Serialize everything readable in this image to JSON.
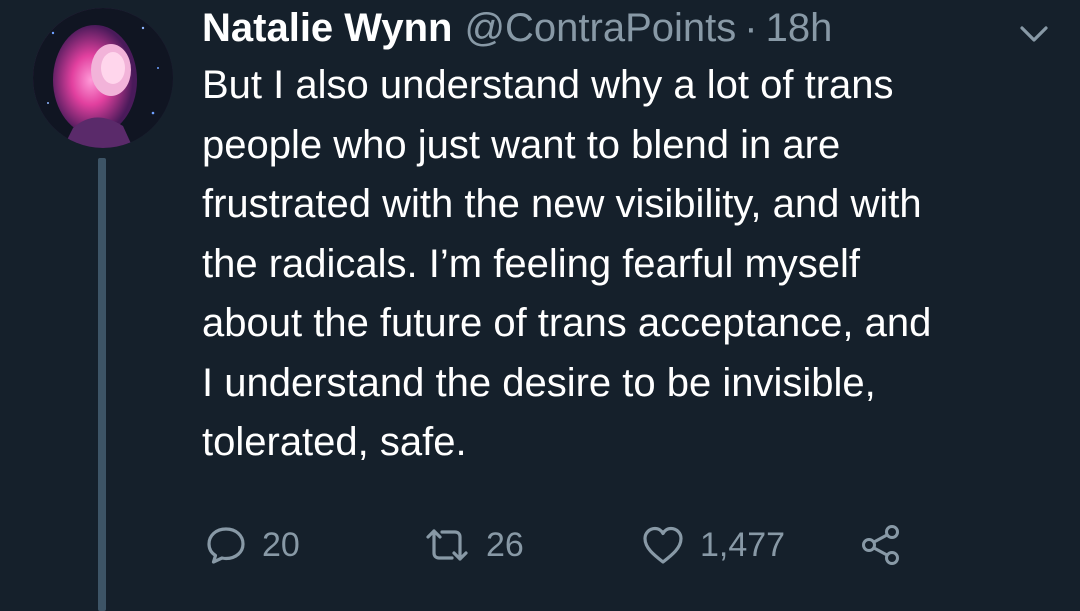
{
  "tweet": {
    "author_name": "Natalie Wynn",
    "handle": "@ContraPoints",
    "separator": "·",
    "time": "18h",
    "text_lines": [
      "But I also understand why a lot of trans",
      "people who just want to blend in are",
      "frustrated with the new visibility, and with",
      "the radicals. I’m feeling fearful myself",
      "about the future of trans acceptance, and",
      "I understand the desire to be invisible,",
      "tolerated, safe."
    ]
  },
  "actions": {
    "reply_count": "20",
    "retweet_count": "26",
    "like_count": "1,477"
  },
  "icons": {
    "reply": "speech-bubble-icon",
    "retweet": "retweet-arrows-icon",
    "like": "heart-outline-icon",
    "share": "share-nodes-icon",
    "menu": "chevron-down-icon"
  },
  "colors": {
    "background": "#15202b",
    "text": "#ffffff",
    "muted": "#8899a6",
    "thread_line": "#3d5466"
  }
}
